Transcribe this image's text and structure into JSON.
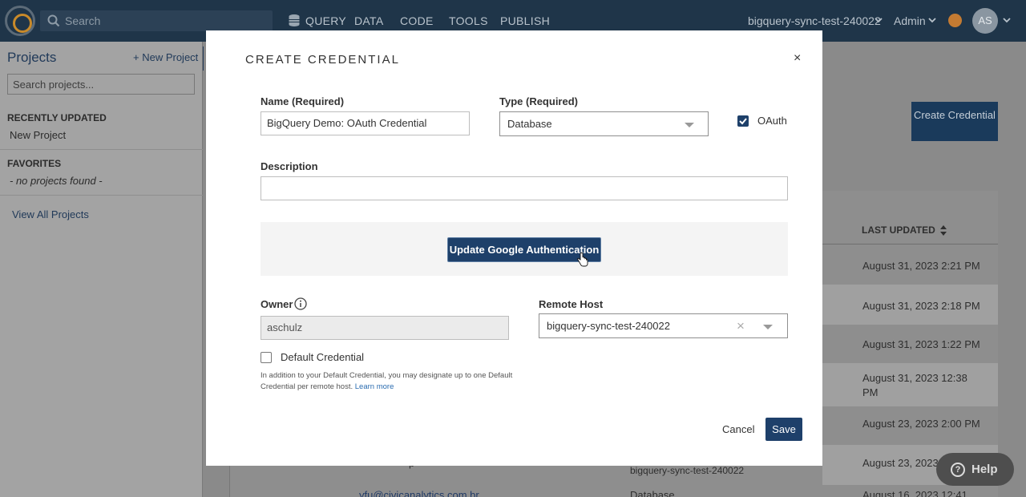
{
  "topnav": {
    "search_placeholder": "Search",
    "items": [
      "QUERY",
      "DATA",
      "CODE",
      "TOOLS",
      "PUBLISH"
    ],
    "workspace": "bigquery-sync-test-240022",
    "role": "Admin",
    "avatar_initials": "AS"
  },
  "sidebar": {
    "title": "Projects",
    "new_project": "+ New Project",
    "search_placeholder": "Search projects...",
    "recently_updated_heading": "RECENTLY UPDATED",
    "recent_items": [
      "New Project"
    ],
    "favorites_heading": "FAVORITES",
    "favorites_empty": "- no projects found -",
    "view_all": "View All Projects"
  },
  "background": {
    "create_button": "Create Credential",
    "column_last_updated": "LAST UPDATED",
    "dates": [
      "August 31, 2023 2:21 PM",
      "August 31, 2023 2:18 PM",
      "August 31, 2023 1:22 PM",
      "August 31, 2023 12:38 PM",
      "August 23, 2023 2:00 PM",
      "August 23, 2023 1",
      "August 16, 2023 12:41"
    ],
    "partial_host": "bigquery-sync-test-240022",
    "partial_email": "yfu@civicanalytics.com.br",
    "partial_type": "Database",
    "partial_text": "p"
  },
  "modal": {
    "title": "CREATE CREDENTIAL",
    "close": "×",
    "name_label": "Name (Required)",
    "name_value": "BigQuery Demo: OAuth Credential",
    "type_label": "Type (Required)",
    "type_value": "Database",
    "oauth_label": "OAuth",
    "oauth_checked": true,
    "description_label": "Description",
    "description_value": "",
    "auth_button": "Update Google Authentication",
    "owner_label": "Owner",
    "owner_value": "aschulz",
    "remote_host_label": "Remote Host",
    "remote_host_value": "bigquery-sync-test-240022",
    "clear_symbol": "×",
    "default_credential_label": "Default Credential",
    "help_text": "In addition to your Default Credential, you may designate up to one Default Credential per remote host.",
    "learn_more": "Learn more",
    "cancel": "Cancel",
    "save": "Save"
  },
  "help_widget": {
    "label": "Help",
    "symbol": "?"
  },
  "colors": {
    "primary": "#1e406a",
    "nav_bg": "#1f3549",
    "checkbox": "#1e406a"
  }
}
